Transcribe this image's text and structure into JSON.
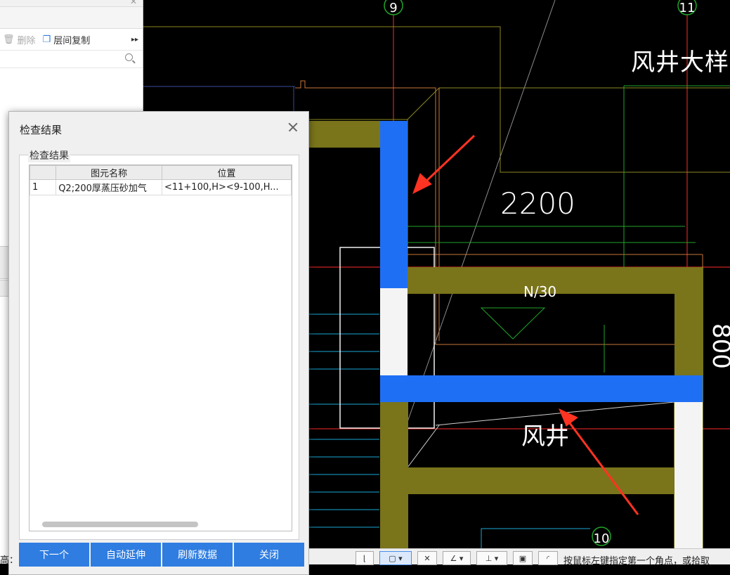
{
  "cad": {
    "axis_labels": [
      "9",
      "11",
      "10"
    ],
    "texts": {
      "title": "风井大样一",
      "dim1": "2200",
      "dim2": "800",
      "partial": "N/30",
      "shaft": "风井"
    }
  },
  "left_panel": {
    "toolbar": {
      "delete_label": "删除",
      "copy_label": "层间复制"
    },
    "search": {
      "placeholder": ""
    }
  },
  "dialog": {
    "title": "检查结果",
    "group_title": "检查结果",
    "columns": [
      "图元名称",
      "位置"
    ],
    "rows": [
      {
        "index": "1",
        "name": "Q2;200厚蒸压砂加气",
        "position": "<11+100,H><9-100,H..."
      }
    ],
    "buttons": {
      "next": "下一个",
      "auto_extend": "自动延伸",
      "refresh": "刷新数据",
      "close": "关闭"
    }
  },
  "statusbar": {
    "hint": "按鼠标左键指定第一个角点，或拾取",
    "left_fragment": "高："
  },
  "colors": {
    "wall_olive": "#7a741b",
    "highlight_blue": "#1f6ff5",
    "button_blue": "#2f7de1",
    "arrow_red": "#ff3322"
  }
}
